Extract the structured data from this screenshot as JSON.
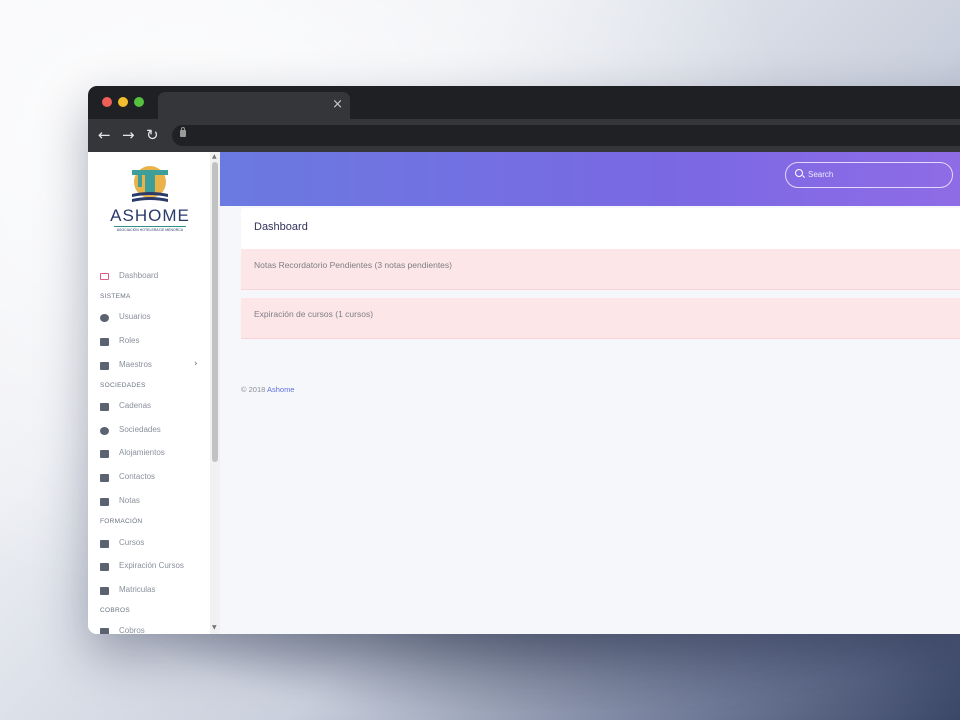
{
  "browser": {
    "tab_close": "×",
    "nav_back": "←",
    "nav_forward": "→",
    "nav_reload": "↻"
  },
  "sidebar": {
    "logo_text": "ASHOME",
    "logo_subtitle": "ASOCIACIÓN HOTELERA DE MENORCA",
    "items": [
      {
        "label": "Dashboard",
        "icon": "monitor-icon"
      },
      {
        "section": "SISTEMA"
      },
      {
        "label": "Usuarios",
        "icon": "user-circle-icon"
      },
      {
        "label": "Roles",
        "icon": "users-icon"
      },
      {
        "label": "Maestros",
        "icon": "share-icon",
        "arrow": "›"
      },
      {
        "section": "SOCIEDADES"
      },
      {
        "label": "Cadenas",
        "icon": "link-icon"
      },
      {
        "label": "Sociedades",
        "icon": "user-icon"
      },
      {
        "label": "Alojamientos",
        "icon": "building-icon"
      },
      {
        "label": "Contactos",
        "icon": "contact-card-icon"
      },
      {
        "label": "Notas",
        "icon": "note-icon"
      },
      {
        "section": "FORMACIÓN"
      },
      {
        "label": "Cursos",
        "icon": "book-icon"
      },
      {
        "label": "Expiración Cursos",
        "icon": "book-icon"
      },
      {
        "label": "Matriculas",
        "icon": "edit-icon"
      },
      {
        "section": "COBROS"
      },
      {
        "label": "Cobros",
        "icon": "book-icon"
      }
    ]
  },
  "header": {
    "search_placeholder": "Search"
  },
  "main": {
    "card_title": "Dashboard",
    "alerts": [
      "Notas Recordatorio Pendientes (3 notas pendientes)",
      "Expiración de cursos (1 cursos)"
    ],
    "footer_copyright": "© 2018",
    "footer_link": "Ashome"
  },
  "colors": {
    "accent": "#5e72e4",
    "header_gradient_start": "#6a7ae0",
    "header_gradient_end": "#8f6ce6",
    "alert_bg": "#fde6e8"
  }
}
